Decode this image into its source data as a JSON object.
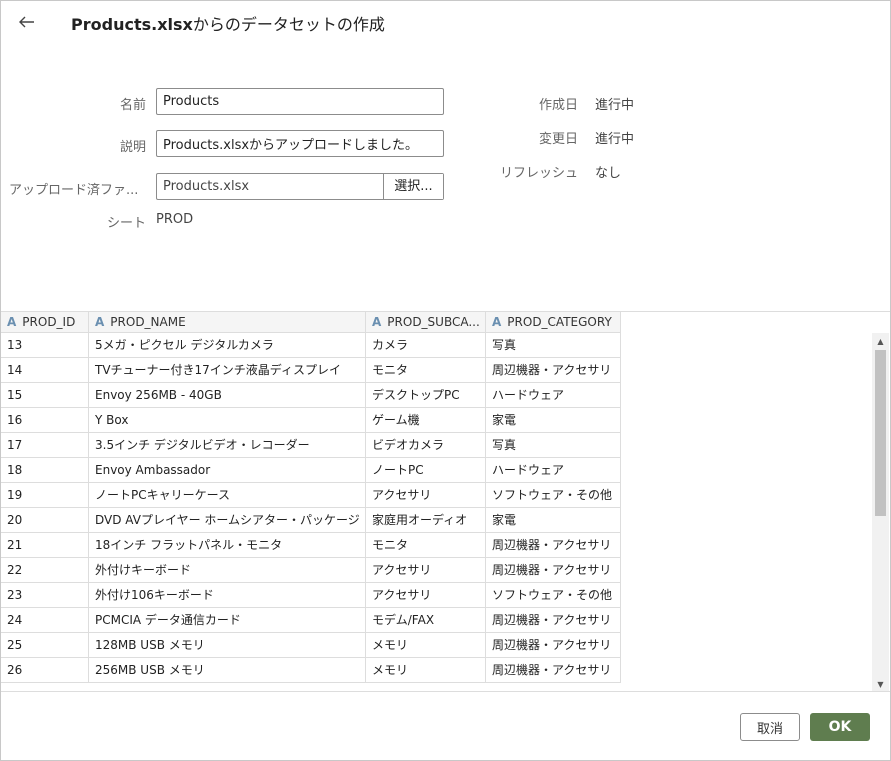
{
  "dialog": {
    "title_bold": "Products.xlsx",
    "title_rest": "からのデータセットの作成"
  },
  "form": {
    "name_label": "名前",
    "name_value": "Products",
    "desc_label": "説明",
    "desc_value": "Products.xlsxからアップロードしました。",
    "file_label": "アップロード済ファ...",
    "file_value": "Products.xlsx",
    "select_label": "選択...",
    "sheet_label": "シート",
    "sheet_value": "PROD"
  },
  "meta": {
    "created_label": "作成日",
    "created_value": "進行中",
    "modified_label": "変更日",
    "modified_value": "進行中",
    "refresh_label": "リフレッシュ",
    "refresh_value": "なし"
  },
  "grid": {
    "type_icon": "text-type-icon",
    "columns": [
      "PROD_ID",
      "PROD_NAME",
      "PROD_SUBCA...",
      "PROD_CATEGORY"
    ],
    "rows": [
      [
        "13",
        "5メガ・ピクセル デジタルカメラ",
        "カメラ",
        "写真"
      ],
      [
        "14",
        "TVチューナー付き17インチ液晶ディスプレイ",
        "モニタ",
        "周辺機器・アクセサリ"
      ],
      [
        "15",
        "Envoy 256MB - 40GB",
        "デスクトップPC",
        "ハードウェア"
      ],
      [
        "16",
        "Y Box",
        "ゲーム機",
        "家電"
      ],
      [
        "17",
        "3.5インチ デジタルビデオ・レコーダー",
        "ビデオカメラ",
        "写真"
      ],
      [
        "18",
        "Envoy Ambassador",
        "ノートPC",
        "ハードウェア"
      ],
      [
        "19",
        "ノートPCキャリーケース",
        "アクセサリ",
        "ソフトウェア・その他"
      ],
      [
        "20",
        "DVD AVプレイヤー ホームシアター・パッケージ",
        "家庭用オーディオ",
        "家電"
      ],
      [
        "21",
        "18インチ フラットパネル・モニタ",
        "モニタ",
        "周辺機器・アクセサリ"
      ],
      [
        "22",
        "外付けキーボード",
        "アクセサリ",
        "周辺機器・アクセサリ"
      ],
      [
        "23",
        "外付け106キーボード",
        "アクセサリ",
        "ソフトウェア・その他"
      ],
      [
        "24",
        "PCMCIA データ通信カード",
        "モデム/FAX",
        "周辺機器・アクセサリ"
      ],
      [
        "25",
        "128MB USB メモリ",
        "メモリ",
        "周辺機器・アクセサリ"
      ],
      [
        "26",
        "256MB USB メモリ",
        "メモリ",
        "周辺機器・アクセサリ"
      ]
    ]
  },
  "footer": {
    "cancel_label": "取消",
    "ok_label": "OK"
  },
  "colors": {
    "ok_button": "#5f7d4f",
    "type_icon": "#6a8fb0"
  }
}
